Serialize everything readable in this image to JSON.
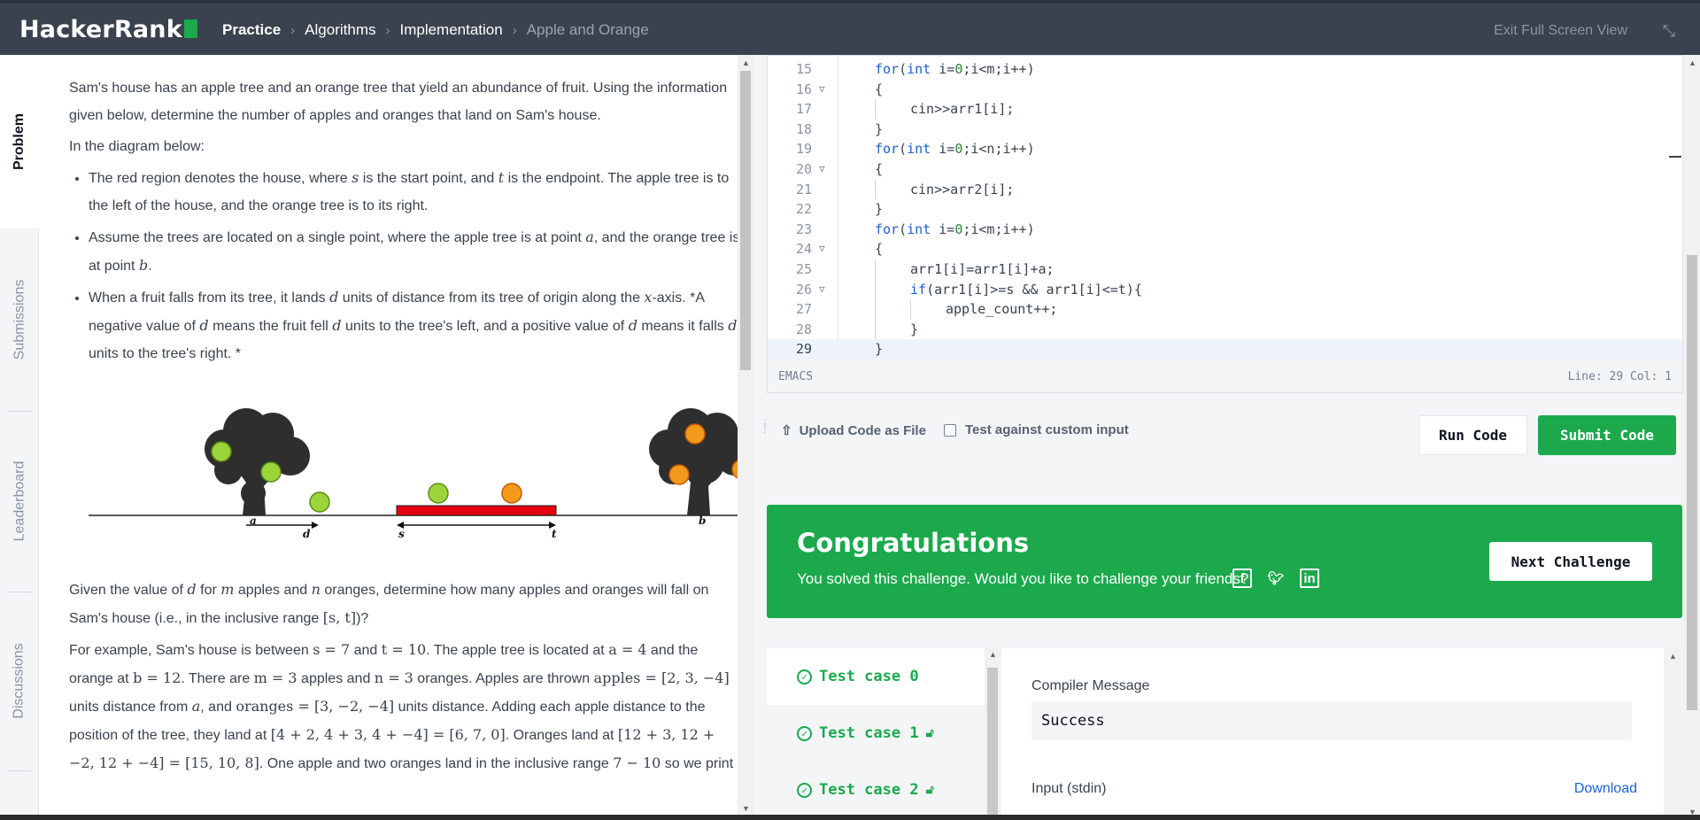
{
  "header": {
    "logo": "HackerRank",
    "breadcrumbs": [
      "Practice",
      "Algorithms",
      "Implementation",
      "Apple and Orange"
    ],
    "exit_fullscreen": "Exit Full Screen View"
  },
  "side_tabs": [
    "Problem",
    "Submissions",
    "Leaderboard",
    "Discussions"
  ],
  "problem": {
    "intro": "Sam's house has an apple tree and an orange tree that yield an abundance of fruit. Using the information given below, determine the number of apples and oranges that land on Sam's house.",
    "diagram_intro": "In the diagram below:",
    "bullets": [
      {
        "a": "The red region denotes the house, where ",
        "v1": "s",
        "b": " is the start point, and ",
        "v2": "t",
        "c": " is the endpoint. The apple tree is to the left of the house, and the orange tree is to its right."
      },
      {
        "a": "Assume the trees are located on a single point, where the apple tree is at point ",
        "v1": "a",
        "b": ", and the orange tree is at point ",
        "v2": "b",
        "c": "."
      },
      {
        "a": "When a fruit falls from its tree, it lands ",
        "v1": "d",
        "b": " units of distance from its tree of origin along the ",
        "v2": "x",
        "c": "-axis. *A negative value of ",
        "v3": "d",
        "d": " means the fruit fell ",
        "v4": "d",
        "e": " units to the tree's left, and a positive value of ",
        "v5": "d",
        "f": " means it falls ",
        "v6": "d",
        "g": " units to the tree's right. *"
      }
    ],
    "diagram_labels": {
      "a": "a",
      "d": "d",
      "s": "s",
      "t": "t",
      "b": "b"
    },
    "given": {
      "p1": "Given the value of ",
      "v1": "d",
      "p2": " for ",
      "v2": "m",
      "p3": " apples and ",
      "v3": "n",
      "p4": " oranges, determine how many apples and oranges will fall on Sam's house (i.e., in the inclusive range ",
      "v4": "[s, t]",
      "p5": ")?"
    },
    "example": {
      "p1": "For example, Sam's house is between ",
      "m1": "s = 7",
      "p2": " and ",
      "m2": "t = 10",
      "p3": ". The apple tree is located at ",
      "m3": "a = 4",
      "p4": " and the orange at ",
      "m4": "b = 12",
      "p5": ". There are ",
      "m5": "m = 3",
      "p6": " apples and ",
      "m6": "n = 3",
      "p7": " oranges. Apples are thrown ",
      "m7": "apples = [2, 3, −4]",
      "p8": " units distance from ",
      "m8": "a",
      "p9": ", and ",
      "m9": "oranges = [3, −2, −4]",
      "p10": " units distance. Adding each apple distance to the position of the tree, they land at ",
      "m10": "[4 + 2, 4 + 3, 4 + −4] = [6, 7, 0]",
      "p11": ". Oranges land at ",
      "m11": "[12 + 3, 12 + −2, 12 + −4] = [15, 10, 8]",
      "p12": ". One apple and two oranges land in the inclusive range ",
      "m12": "7 − 10",
      "p13": " so we print"
    }
  },
  "editor": {
    "lines": [
      {
        "n": "15",
        "fold": false
      },
      {
        "n": "16",
        "fold": true
      },
      {
        "n": "17",
        "fold": false
      },
      {
        "n": "18",
        "fold": false
      },
      {
        "n": "19",
        "fold": false
      },
      {
        "n": "20",
        "fold": true
      },
      {
        "n": "21",
        "fold": false
      },
      {
        "n": "22",
        "fold": false
      },
      {
        "n": "23",
        "fold": false
      },
      {
        "n": "24",
        "fold": true
      },
      {
        "n": "25",
        "fold": false
      },
      {
        "n": "26",
        "fold": true
      },
      {
        "n": "27",
        "fold": false
      },
      {
        "n": "28",
        "fold": false
      },
      {
        "n": "29",
        "fold": false
      }
    ],
    "code": {
      "l15a": "for",
      "l15b": "(",
      "l15c": "int",
      "l15d": " i=",
      "l15e": "0",
      "l15f": ";i<m;i++)",
      "l16": "{",
      "l17": "cin>>arr1[i];",
      "l18": "}",
      "l19a": "for",
      "l19b": "(",
      "l19c": "int",
      "l19d": " i=",
      "l19e": "0",
      "l19f": ";i<n;i++)",
      "l20": "{",
      "l21": "cin>>arr2[i];",
      "l22": "}",
      "l23a": "for",
      "l23b": "(",
      "l23c": "int",
      "l23d": " i=",
      "l23e": "0",
      "l23f": ";i<m;i++)",
      "l24": "{",
      "l25": "arr1[i]=arr1[i]+a;",
      "l26a": "if",
      "l26b": "(arr1[i]>=s && arr1[i]<=t){",
      "l27": "apple_count++;",
      "l28": "}",
      "l29": "}"
    },
    "mode": "EMACS",
    "cursor": "Line: 29 Col: 1"
  },
  "actions": {
    "upload": "Upload Code as File",
    "custom_input": "Test against custom input",
    "run": "Run Code",
    "submit": "Submit Code"
  },
  "congrats": {
    "title": "Congratulations",
    "subtitle": "You solved this challenge. Would you like to challenge your friends?",
    "next": "Next Challenge"
  },
  "testcases": [
    {
      "label": "Test case 0",
      "locked": false
    },
    {
      "label": "Test case 1",
      "locked": true
    },
    {
      "label": "Test case 2",
      "locked": true
    }
  ],
  "results": {
    "compiler_label": "Compiler Message",
    "compiler_value": "Success",
    "input_label": "Input (stdin)",
    "download": "Download"
  },
  "colors": {
    "brand_green": "#1ba94c",
    "header_bg": "#39424e",
    "link_blue": "#1b60d8",
    "house_red": "#e4000f"
  }
}
